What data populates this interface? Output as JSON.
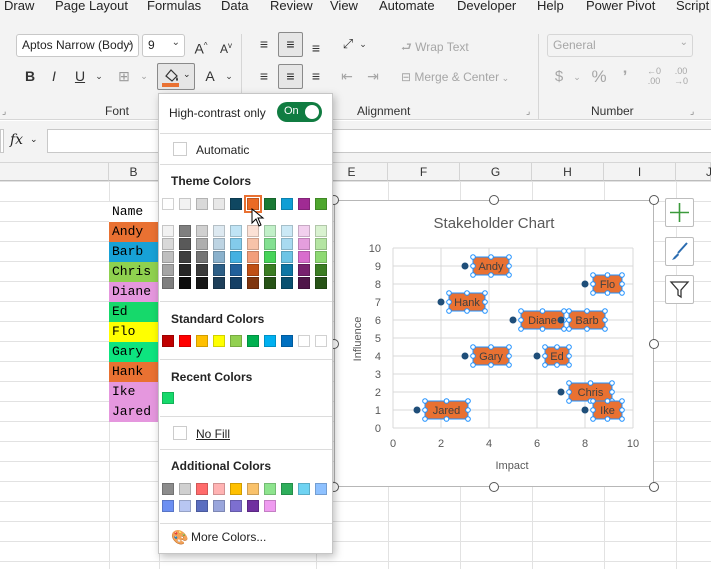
{
  "menu": [
    "Draw",
    "Page Layout",
    "Formulas",
    "Data",
    "Review",
    "View",
    "Automate",
    "Developer",
    "Help",
    "Power Pivot",
    "Script"
  ],
  "ribbon": {
    "font_name": "Aptos Narrow (Body)",
    "font_size": "9",
    "groups": {
      "font": "Font",
      "alignment": "Alignment",
      "number": "Number"
    },
    "wrap_text": "Wrap Text",
    "merge_center": "Merge & Center",
    "number_format": "General",
    "currency_symbol": "$",
    "percent_symbol": "%",
    "comma_symbol": "’",
    "bold": "B",
    "italic": "I",
    "underline": "U",
    "font_color_letter": "A",
    "fill_color": "#e97132"
  },
  "formula_bar": {
    "fx": "fx"
  },
  "columns": [
    "B",
    "E",
    "F",
    "G",
    "H",
    "I",
    "J"
  ],
  "cells": {
    "header": "Name",
    "names": [
      {
        "text": "Andy",
        "color": "#e97132"
      },
      {
        "text": "Barb",
        "color": "#17a1d6"
      },
      {
        "text": "Chris",
        "color": "#8fd14f"
      },
      {
        "text": "Diane",
        "color": "#e597de"
      },
      {
        "text": "Ed",
        "color": "#16d96b"
      },
      {
        "text": "Flo",
        "color": "#ffff00"
      },
      {
        "text": "Gary",
        "color": "#0de47f"
      },
      {
        "text": "Hank",
        "color": "#e97132"
      },
      {
        "text": "Ike",
        "color": "#e597de"
      },
      {
        "text": "Jared",
        "color": "#e597de"
      }
    ]
  },
  "chart_data": {
    "type": "scatter",
    "title": "Stakeholder Chart",
    "xlabel": "Impact",
    "ylabel": "Influence",
    "xlim": [
      0,
      10
    ],
    "ylim": [
      0,
      10
    ],
    "xticks": [
      0,
      2,
      4,
      6,
      8,
      10
    ],
    "yticks": [
      0,
      1,
      2,
      3,
      4,
      5,
      6,
      7,
      8,
      9,
      10
    ],
    "grid": true,
    "marker_color": "#1f4e79",
    "label_fill": "#e97132",
    "points": [
      {
        "label": "Andy",
        "x": 3,
        "y": 9
      },
      {
        "label": "Flo",
        "x": 8,
        "y": 8
      },
      {
        "label": "Hank",
        "x": 2,
        "y": 7
      },
      {
        "label": "Diane",
        "x": 5,
        "y": 6
      },
      {
        "label": "Barb",
        "x": 7,
        "y": 6
      },
      {
        "label": "Gary",
        "x": 3,
        "y": 4
      },
      {
        "label": "Ed",
        "x": 6,
        "y": 4
      },
      {
        "label": "Chris",
        "x": 7,
        "y": 2
      },
      {
        "label": "Jared",
        "x": 1,
        "y": 1
      },
      {
        "label": "Ike",
        "x": 8,
        "y": 1
      }
    ]
  },
  "color_menu": {
    "high_contrast_label": "High-contrast only",
    "toggle_label": "On",
    "automatic": "Automatic",
    "theme_colors_title": "Theme Colors",
    "theme_top": [
      "#ffffff",
      "#f2f2f2",
      "#d9d9d9",
      "#e8e8e8",
      "#0f4761",
      "#ea6a25",
      "#1a7a34",
      "#0f9ed5",
      "#a02b93",
      "#4ea72e"
    ],
    "theme_shades": [
      [
        "#f2f2f2",
        "#7f7f7f",
        "#d0d0d0",
        "#dde9f1",
        "#c0e4f5",
        "#fbe1d5",
        "#c1f0c8",
        "#cbe9f6",
        "#f2cfee",
        "#d9f2d0"
      ],
      [
        "#d9d9d9",
        "#595959",
        "#aeaeae",
        "#bdd4e3",
        "#83cbeb",
        "#f7c3a9",
        "#83e091",
        "#a8daf0",
        "#e59edd",
        "#b4e5a2"
      ],
      [
        "#bfbfbf",
        "#3f3f3f",
        "#757575",
        "#8ab1cc",
        "#45b0e1",
        "#f29e7b",
        "#47d359",
        "#6dc4e5",
        "#d86dcd",
        "#8ed973"
      ],
      [
        "#a5a5a5",
        "#262626",
        "#3a3a3a",
        "#2d5f87",
        "#215f9a",
        "#c04f15",
        "#3b7d23",
        "#0e76a4",
        "#78206e",
        "#3b7d23"
      ],
      [
        "#7f7f7f",
        "#0d0d0d",
        "#171717",
        "#1e3f5a",
        "#153f65",
        "#80350e",
        "#275317",
        "#095070",
        "#501549",
        "#275317"
      ]
    ],
    "standard_colors_title": "Standard Colors",
    "standard_colors": [
      "#c00000",
      "#ff0000",
      "#ffc000",
      "#ffff00",
      "#92d050",
      "#00b050",
      "#00b0f0",
      "#0070c0",
      "#ffffff",
      "#ffffff"
    ],
    "recent_colors_title": "Recent Colors",
    "recent_colors": [
      "#16d96b"
    ],
    "no_fill": "No Fill",
    "additional_colors_title": "Additional Colors",
    "additional_colors": [
      [
        "#8c8c8c",
        "#d0d0d0",
        "#ff6b6b",
        "#ffb3b3",
        "#ffc000",
        "#f9c26b",
        "#8ee48e",
        "#2eae5b",
        "#6fd3f2",
        "#8ec1ff"
      ],
      [
        "#6c8ff2",
        "#b8c6f2",
        "#5b6ec0",
        "#9aa6dc",
        "#7d6fd0",
        "#7030a0",
        "#ef9bf0"
      ]
    ],
    "more_colors": "More Colors..."
  }
}
